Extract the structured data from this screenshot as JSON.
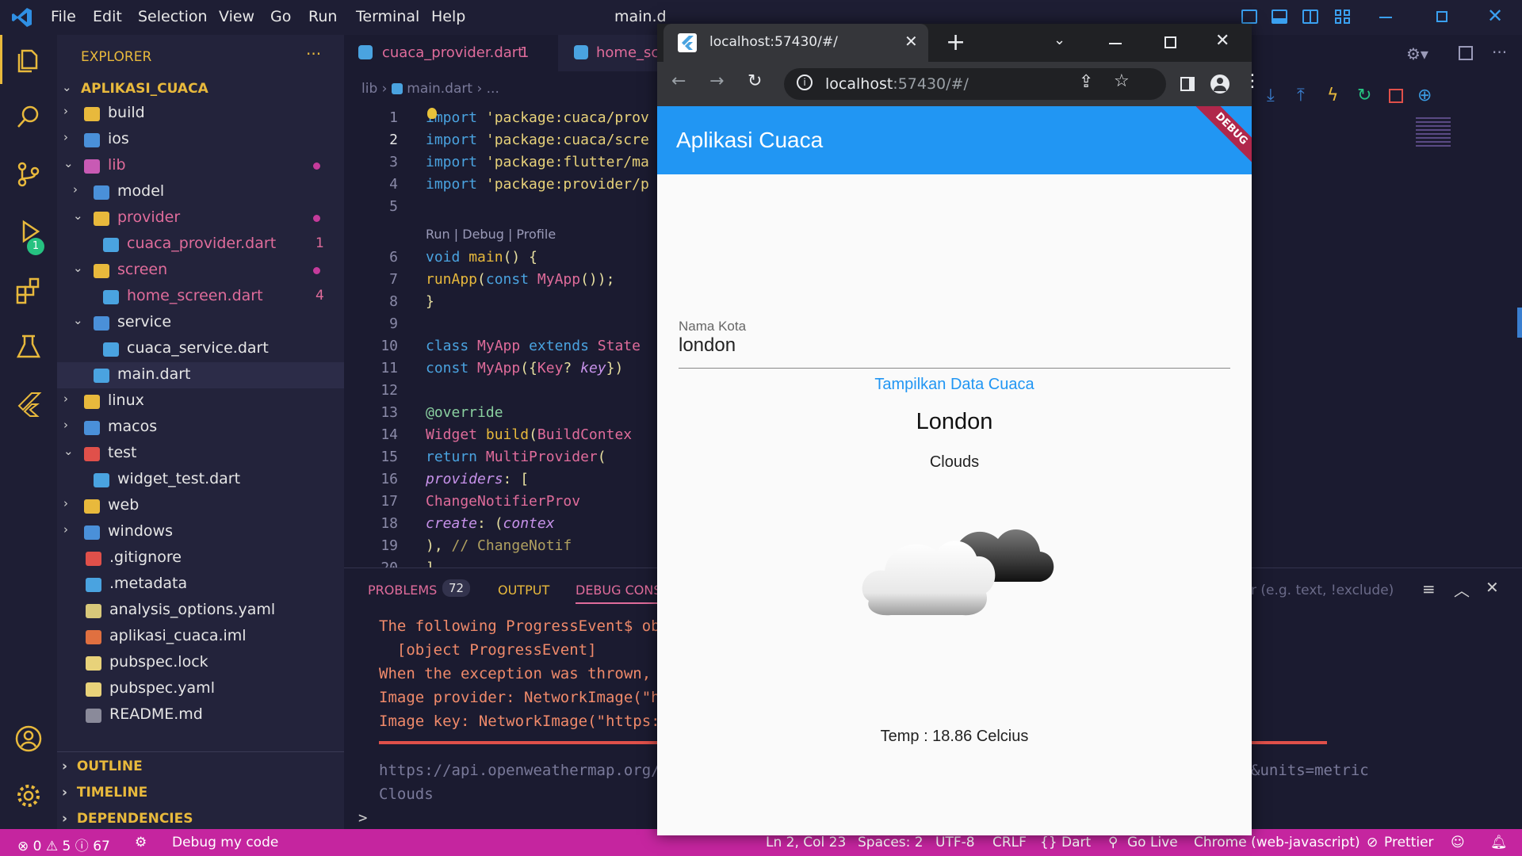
{
  "menu": [
    "File",
    "Edit",
    "Selection",
    "View",
    "Go",
    "Run",
    "Terminal",
    "Help"
  ],
  "window_title": "main.d",
  "explorer": {
    "title": "EXPLORER",
    "more": "···",
    "root": "APLIKASI_CUACA",
    "items": [
      {
        "label": "build",
        "depth": 1,
        "chev": "›",
        "color": "#e6e6e6",
        "icon": "#e8b93c"
      },
      {
        "label": "ios",
        "depth": 1,
        "chev": "›",
        "color": "#e6e6e6",
        "icon": "#4a90d9"
      },
      {
        "label": "lib",
        "depth": 1,
        "chev": "⌄",
        "color": "#e06c9b",
        "icon": "#c85ab4",
        "dot": true
      },
      {
        "label": "model",
        "depth": 2,
        "chev": "›",
        "color": "#e6e6e6",
        "icon": "#4a90d9"
      },
      {
        "label": "provider",
        "depth": 2,
        "chev": "⌄",
        "color": "#e06c9b",
        "icon": "#e8b93c",
        "dot": true
      },
      {
        "label": "cuaca_provider.dart",
        "depth": 3,
        "chev": "",
        "color": "#e06c9b",
        "icon": "#4aa3e0",
        "count": "1"
      },
      {
        "label": "screen",
        "depth": 2,
        "chev": "⌄",
        "color": "#e06c9b",
        "icon": "#e8b93c",
        "dot": true
      },
      {
        "label": "home_screen.dart",
        "depth": 3,
        "chev": "",
        "color": "#e06c9b",
        "icon": "#4aa3e0",
        "count": "4"
      },
      {
        "label": "service",
        "depth": 2,
        "chev": "⌄",
        "color": "#e6e6e6",
        "icon": "#4a90d9"
      },
      {
        "label": "cuaca_service.dart",
        "depth": 3,
        "chev": "",
        "color": "#e6e6e6",
        "icon": "#4aa3e0"
      },
      {
        "label": "main.dart",
        "depth": 2,
        "chev": "",
        "color": "#e6e6e6",
        "icon": "#4aa3e0",
        "active": true
      },
      {
        "label": "linux",
        "depth": 1,
        "chev": "›",
        "color": "#e6e6e6",
        "icon": "#e8b93c"
      },
      {
        "label": "macos",
        "depth": 1,
        "chev": "›",
        "color": "#e6e6e6",
        "icon": "#4a90d9"
      },
      {
        "label": "test",
        "depth": 1,
        "chev": "⌄",
        "color": "#e6e6e6",
        "icon": "#e0504a"
      },
      {
        "label": "widget_test.dart",
        "depth": 2,
        "chev": "",
        "color": "#e6e6e6",
        "icon": "#4aa3e0"
      },
      {
        "label": "web",
        "depth": 1,
        "chev": "›",
        "color": "#e6e6e6",
        "icon": "#e8b93c"
      },
      {
        "label": "windows",
        "depth": 1,
        "chev": "›",
        "color": "#e6e6e6",
        "icon": "#4a90d9"
      },
      {
        "label": ".gitignore",
        "depth": 1,
        "chev": "",
        "color": "#e6e6e6",
        "icon": "#e0504a"
      },
      {
        "label": ".metadata",
        "depth": 1,
        "chev": "",
        "color": "#e6e6e6",
        "icon": "#4aa3e0"
      },
      {
        "label": "analysis_options.yaml",
        "depth": 1,
        "chev": "",
        "color": "#e6e6e6",
        "icon": "#d8c87a"
      },
      {
        "label": "aplikasi_cuaca.iml",
        "depth": 1,
        "chev": "",
        "color": "#e6e6e6",
        "icon": "#e07040"
      },
      {
        "label": "pubspec.lock",
        "depth": 1,
        "chev": "",
        "color": "#e6e6e6",
        "icon": "#e8d27a"
      },
      {
        "label": "pubspec.yaml",
        "depth": 1,
        "chev": "",
        "color": "#e6e6e6",
        "icon": "#e8d27a"
      },
      {
        "label": "README.md",
        "depth": 1,
        "chev": "",
        "color": "#e6e6e6",
        "icon": "#8a8a9a"
      }
    ],
    "sections": [
      "OUTLINE",
      "TIMELINE",
      "DEPENDENCIES"
    ]
  },
  "editor": {
    "tabs": [
      {
        "label": "cuaca_provider.dart",
        "count": "1"
      },
      {
        "label": "home_sc"
      }
    ],
    "breadcrumb": [
      "lib",
      "main.dart",
      "..."
    ],
    "codelens": "Run | Debug | Profile",
    "lines": [
      {
        "n": "1",
        "t": "import 'package:cuaca/prov"
      },
      {
        "n": "2",
        "t": "import 'package:cuaca/scre"
      },
      {
        "n": "3",
        "t": "import 'package:flutter/ma"
      },
      {
        "n": "4",
        "t": "import 'package:provider/p"
      },
      {
        "n": "5",
        "t": ""
      },
      {
        "n": "6",
        "t": "void main() {"
      },
      {
        "n": "7",
        "t": "  runApp(const MyApp());"
      },
      {
        "n": "8",
        "t": "}"
      },
      {
        "n": "9",
        "t": ""
      },
      {
        "n": "10",
        "t": "class MyApp extends State"
      },
      {
        "n": "11",
        "t": "  const MyApp({Key? key})"
      },
      {
        "n": "12",
        "t": ""
      },
      {
        "n": "13",
        "t": "  @override"
      },
      {
        "n": "14",
        "t": "  Widget build(BuildContex"
      },
      {
        "n": "15",
        "t": "    return MultiProvider("
      },
      {
        "n": "16",
        "t": "      providers: ["
      },
      {
        "n": "17",
        "t": "        ChangeNotifierProv"
      },
      {
        "n": "18",
        "t": "          create: (contex"
      },
      {
        "n": "19",
        "t": "        ), // ChangeNotif"
      },
      {
        "n": "20",
        "t": "      ],"
      }
    ]
  },
  "panel": {
    "tabs": {
      "problems": "PROBLEMS",
      "problems_count": "72",
      "output": "OUTPUT",
      "debug": "DEBUG CONSO"
    },
    "filter_placeholder": "r (e.g. text, !exclude)",
    "lines": [
      "The following ProgressEvent$ ob",
      "  [object ProgressEvent]",
      "When the exception was thrown, ",
      "Image provider: NetworkImage(\"h",
      "Image key: NetworkImage(\"https:"
    ],
    "url_left": "https://api.openweathermap.org/",
    "url_right": "&units=metric",
    "clouds": "Clouds",
    "prompt": ">"
  },
  "statusbar": {
    "errors": "0",
    "warnings": "5",
    "infos": "67",
    "debug": "Debug my code",
    "position": "Ln 2, Col 23",
    "spaces": "Spaces: 2",
    "encoding": "UTF-8",
    "eol": "CRLF",
    "language": "{} Dart",
    "golive": "Go Live",
    "device": "Chrome (web-javascript)",
    "prettier": "Prettier"
  },
  "browser": {
    "tab_title": "localhost:57430/#/",
    "url_host": "localhost",
    "url_rest": ":57430/#/",
    "app": {
      "title": "Aplikasi Cuaca",
      "debug_banner": "DEBUG",
      "field_label": "Nama Kota",
      "field_value": "london",
      "button": "Tampilkan Data Cuaca",
      "city": "London",
      "condition": "Clouds",
      "temp": "Temp : 18.86 Celcius"
    }
  },
  "activity_badge": "1",
  "colors": {
    "status_bar": "#c5259f",
    "app_bar": "#2196f3",
    "accent": "#2196f3"
  }
}
